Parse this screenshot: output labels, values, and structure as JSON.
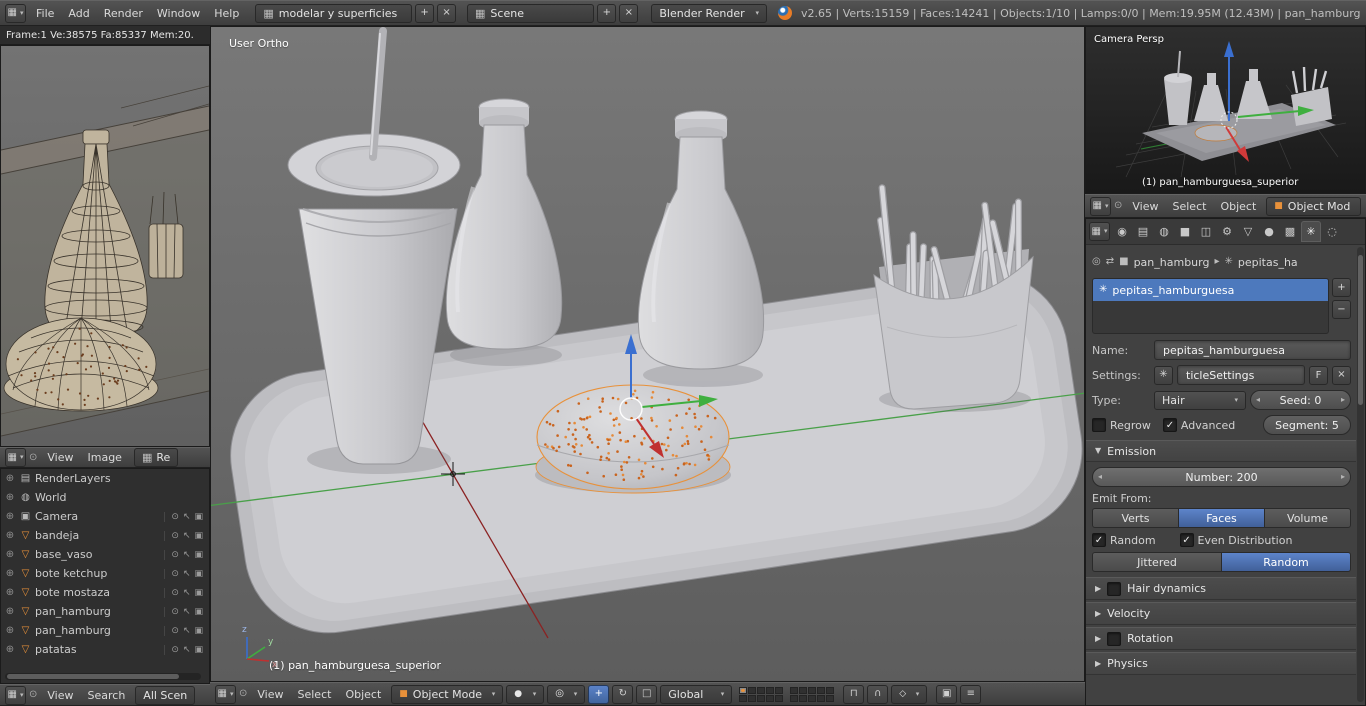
{
  "info_bar": {
    "menus": [
      "File",
      "Add",
      "Render",
      "Window",
      "Help"
    ],
    "layout_name": "modelar y superficies",
    "scene_name": "Scene",
    "engine": "Blender Render",
    "stats": "v2.65 | Verts:15159 | Faces:14241 | Objects:1/10 | Lamps:0/0 | Mem:19.95M (12.43M) | pan_hamburgue"
  },
  "left_viewport": {
    "stats": "Frame:1 Ve:38575 Fa:85337 Mem:20."
  },
  "image_editor": {
    "menus": [
      "View",
      "Image"
    ],
    "datablock": "Re"
  },
  "outliner": {
    "items": [
      {
        "name": "RenderLayers",
        "icon": "renderlayers-icon",
        "object": false
      },
      {
        "name": "World",
        "icon": "world-icon",
        "object": false
      },
      {
        "name": "Camera",
        "icon": "camera-icon",
        "object": true
      },
      {
        "name": "bandeja",
        "icon": "mesh-icon",
        "object": true
      },
      {
        "name": "base_vaso",
        "icon": "mesh-icon",
        "object": true
      },
      {
        "name": "bote ketchup",
        "icon": "mesh-icon",
        "object": true
      },
      {
        "name": "bote mostaza",
        "icon": "mesh-icon",
        "object": true
      },
      {
        "name": "pan_hamburg",
        "icon": "mesh-icon",
        "object": true
      },
      {
        "name": "pan_hamburg",
        "icon": "mesh-icon",
        "object": true
      },
      {
        "name": "patatas",
        "icon": "mesh-icon",
        "object": true
      }
    ],
    "footer_menus": [
      "View",
      "Search"
    ],
    "scope": "All Scen"
  },
  "viewport": {
    "view_label": "User Ortho",
    "active_object": "(1) pan_hamburguesa_superior",
    "menus": [
      "View",
      "Select",
      "Object"
    ],
    "mode": "Object Mode",
    "orientation": "Global",
    "gizmo": [
      "x",
      "y",
      "z"
    ]
  },
  "camera_view": {
    "view_label": "Camera Persp",
    "active_object": "(1) pan_hamburguesa_superior",
    "menus": [
      "View",
      "Select",
      "Object"
    ],
    "mode": "Object Mod"
  },
  "properties": {
    "tabs": [
      "render",
      "scene",
      "world",
      "object",
      "constraints",
      "modifiers",
      "object-data",
      "material",
      "texture",
      "particles",
      "physics"
    ],
    "active_tab": "particles",
    "breadcrumb": {
      "object": "pan_hamburg",
      "particles": "pepitas_ha"
    },
    "list": {
      "items": [
        "pepitas_hamburguesa"
      ],
      "selected": "pepitas_hamburguesa"
    },
    "fields": {
      "name_label": "Name:",
      "name_value": "pepitas_hamburguesa",
      "settings_label": "Settings:",
      "settings_value": "ticleSettings",
      "fake_user": "F",
      "type_label": "Type:",
      "type_value": "Hair",
      "seed": "Seed: 0",
      "regrow": "Regrow",
      "advanced": "Advanced",
      "segments": "Segment: 5"
    },
    "emission": {
      "title": "Emission",
      "number": "Number: 200",
      "emit_from": "Emit From:",
      "emit_options": [
        "Verts",
        "Faces",
        "Volume"
      ],
      "emit_selected": "Faces",
      "random": "Random",
      "even_distribution": "Even Distribution",
      "distribution_options": [
        "Jittered",
        "Random"
      ],
      "distribution_selected": "Random"
    },
    "panels": [
      {
        "label": "Hair dynamics",
        "checkbox": true,
        "checked": false
      },
      {
        "label": "Velocity",
        "checkbox": false,
        "checked": false
      },
      {
        "label": "Rotation",
        "checkbox": true,
        "checked": false
      },
      {
        "label": "Physics",
        "checkbox": false,
        "checked": false
      }
    ]
  },
  "viewport_scene": {
    "particle_count": 150,
    "fry_count": 16,
    "wire_dot_count": 55
  },
  "colors": {
    "accent_blue": "#4d79bd",
    "selection_orange": "#e8913a",
    "axis_x_red": "#c03030",
    "axis_y_green": "#3faf3f",
    "axis_z_blue": "#3a6fd0"
  },
  "icons": {
    "editor-icon": "▦",
    "caret-down-icon": "▾",
    "collapse-menu-icon": "⊙",
    "browse-icon": "▦",
    "plus-icon": "+",
    "minus-icon": "−",
    "close-icon": "×",
    "expand-icon": "⊕",
    "eye-icon": "⊙",
    "cursor-icon": "↖",
    "camera-icon": "▣",
    "renderlayers-icon": "▤",
    "world-icon": "◍",
    "mesh-icon": "▽",
    "check-icon": "✓",
    "pin-icon": "◎",
    "arrows-icon": "⇄",
    "chevron-right-icon": "▸",
    "panel-open-icon": "▼",
    "panel-closed-icon": "▶",
    "arrow-left-icon": "◂",
    "arrow-right-icon": "▸",
    "object-mode-cube-icon": "■",
    "shading-sphere-icon": "●",
    "pivot-icon": "◎",
    "translate-icon": "+",
    "rotate-icon": "↻",
    "scale-icon": "□",
    "magnet-icon": "∩",
    "snap-target-icon": "◇",
    "lock-icon": "⊓",
    "render-camera-icon": "▣",
    "render-ops-icon": "≡",
    "render-tab-icon": "◉",
    "scene-tab-icon": "▤",
    "world-tab-icon": "◍",
    "object-tab-icon": "■",
    "constraints-tab-icon": "◫",
    "modifiers-tab-icon": "⚙",
    "object-data-tab-icon": "▽",
    "material-tab-icon": "●",
    "texture-tab-icon": "▩",
    "particles-tab-icon": "✳",
    "physics-tab-icon": "◌"
  }
}
